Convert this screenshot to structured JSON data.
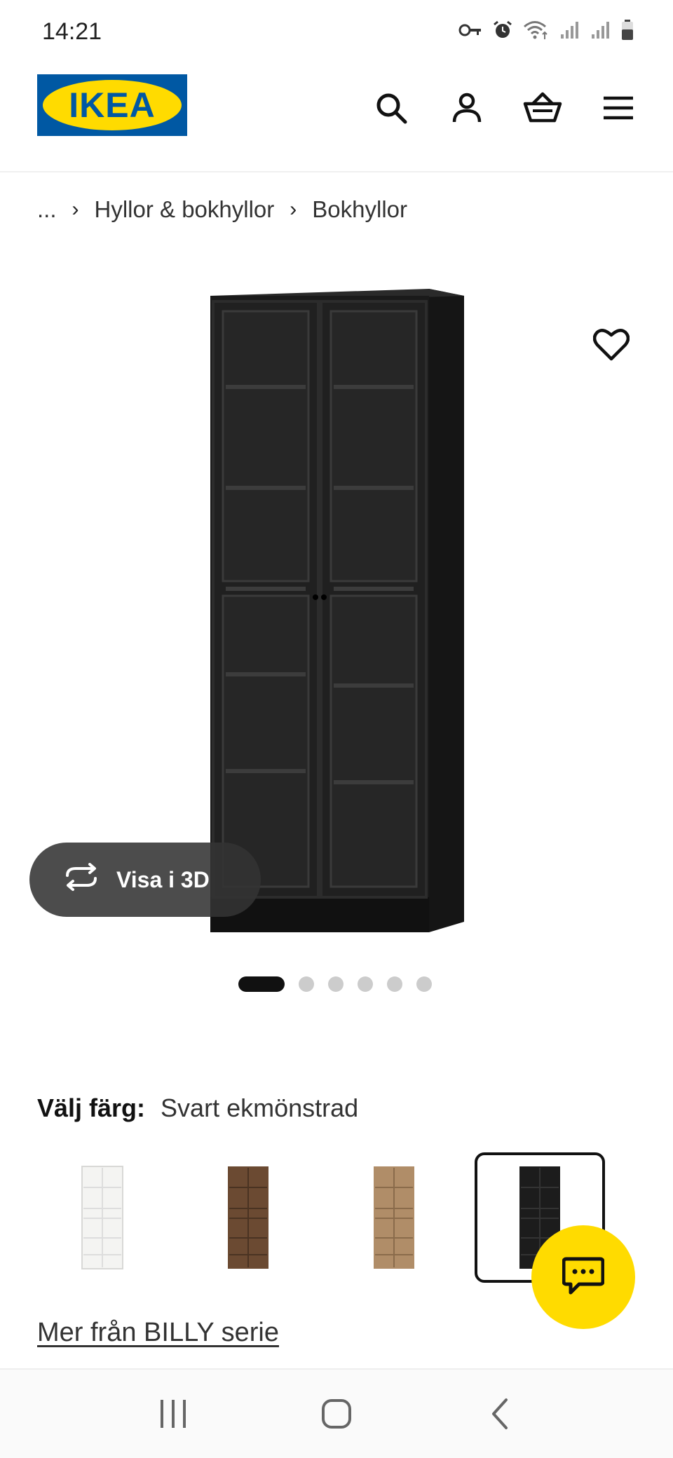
{
  "status_bar": {
    "time": "14:21",
    "icons": [
      "vpn-key-icon",
      "alarm-icon",
      "wifi-icon",
      "signal-icon",
      "signal-icon",
      "battery-icon"
    ]
  },
  "header": {
    "logo_text": "IKEA",
    "icons": [
      "search-icon",
      "account-icon",
      "basket-icon",
      "menu-icon"
    ]
  },
  "breadcrumb": {
    "ellipsis": "...",
    "items": [
      "Hyllor & bokhyllor",
      "Bokhyllor"
    ]
  },
  "product": {
    "view_3d_label": "Visa i 3D",
    "image_count": 6,
    "active_image": 1
  },
  "color": {
    "label": "Välj färg:",
    "value": "Svart ekmönstrad",
    "swatches": [
      {
        "name": "white",
        "color": "#f2f2f0",
        "selected": false
      },
      {
        "name": "brown",
        "color": "#6b4a32",
        "selected": false
      },
      {
        "name": "oak",
        "color": "#b08d68",
        "selected": false
      },
      {
        "name": "black",
        "color": "#1c1c1c",
        "selected": true
      }
    ]
  },
  "series_link": "Mer från BILLY serie",
  "colors": {
    "brand_blue": "#0058a3",
    "brand_yellow": "#ffdb00"
  }
}
